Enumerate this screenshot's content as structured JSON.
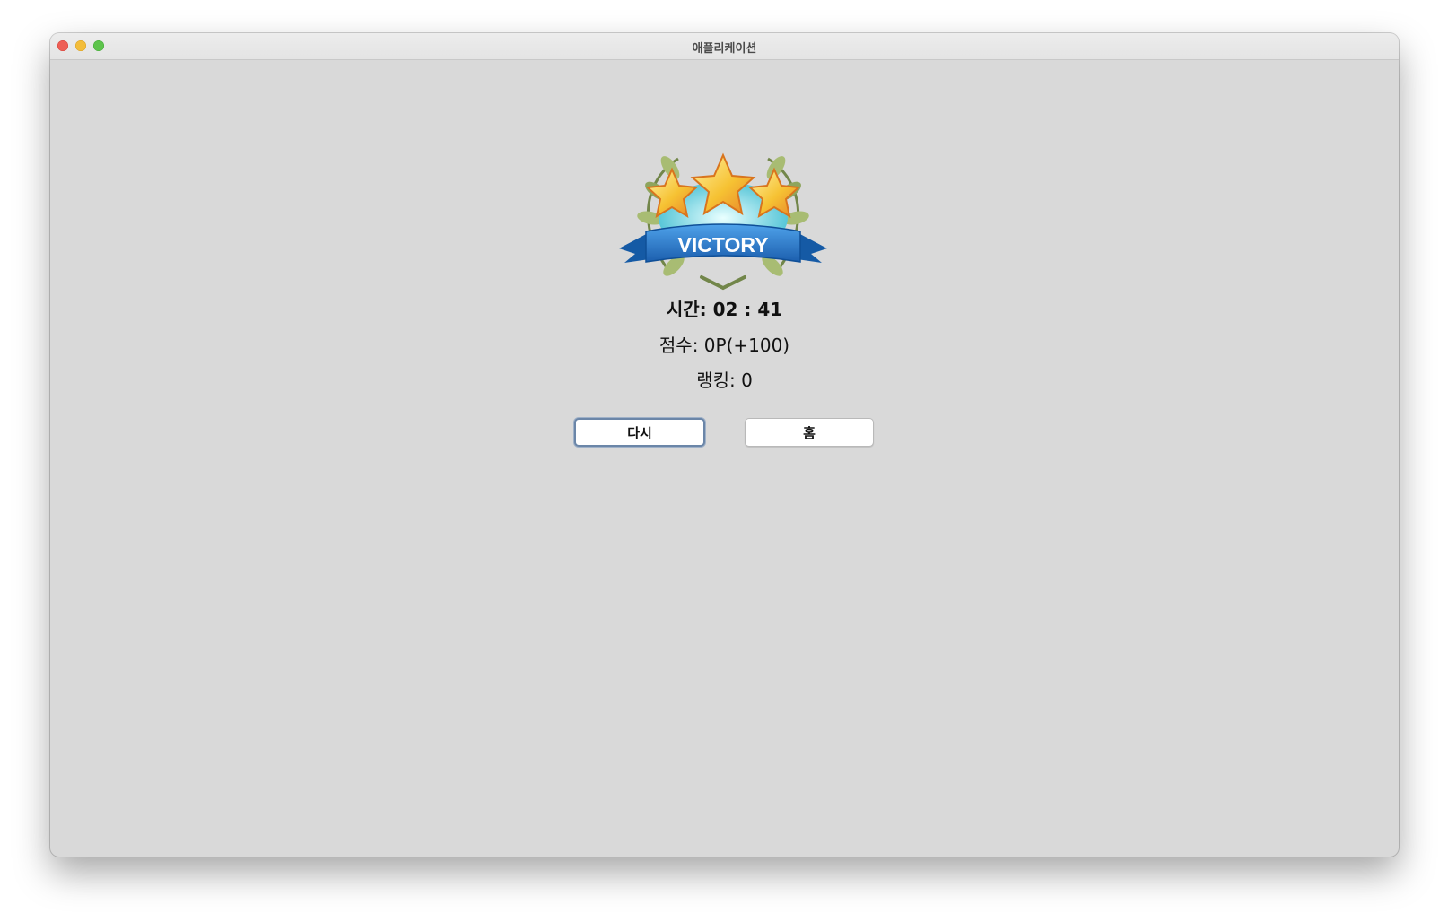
{
  "window": {
    "title": "애플리케이션"
  },
  "emblem": {
    "banner_text": "VICTORY",
    "stars": 3,
    "colors": {
      "ribbon": "#2f7fd0",
      "star": "#f6c233",
      "laurel": "#7f9a4e"
    }
  },
  "stats": {
    "time": "시간: 02 : 41",
    "score": "점수: 0P(+100)",
    "ranking": "랭킹: 0"
  },
  "buttons": {
    "retry": "다시",
    "home": "홈"
  }
}
